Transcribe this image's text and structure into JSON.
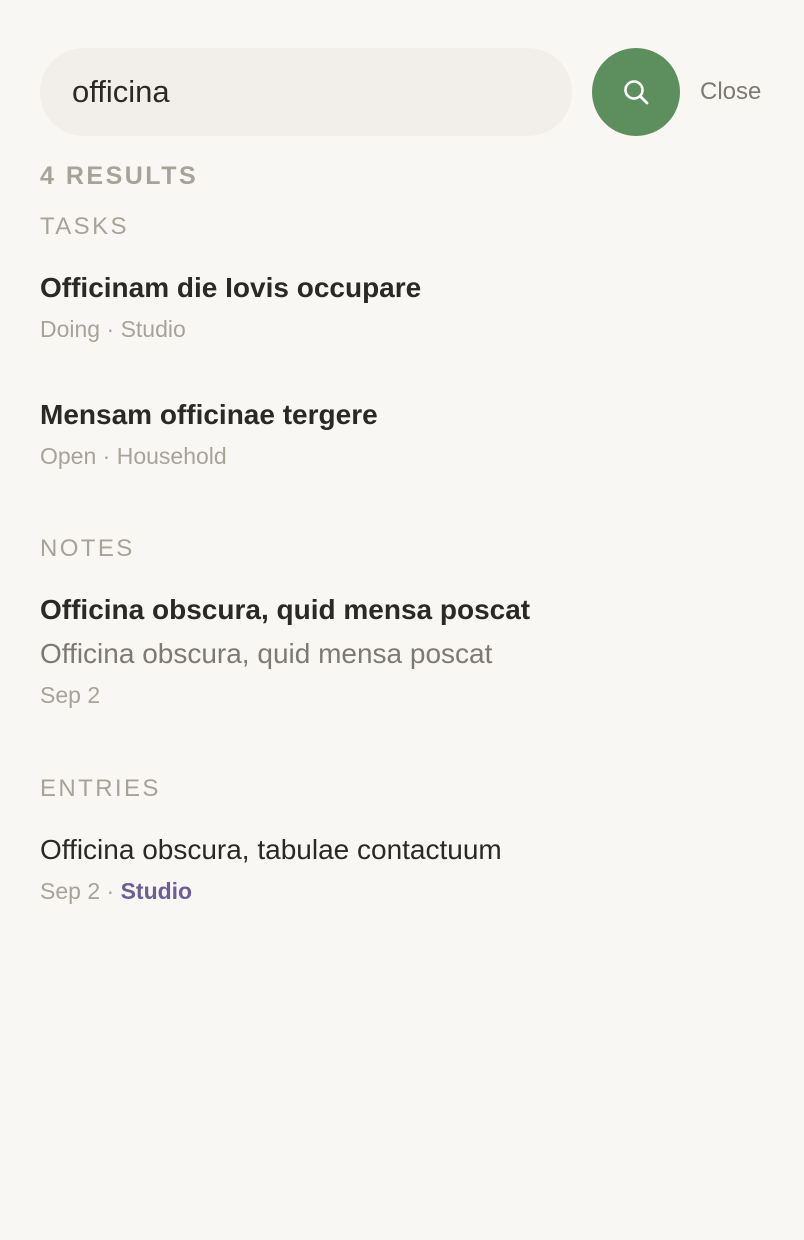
{
  "search": {
    "value": "officina",
    "button_icon": "search-icon",
    "close_label": "Close"
  },
  "results_count": "4 RESULTS",
  "colors": {
    "background": "#f9f7f3",
    "search_field": "#f2efea",
    "accent_green": "#5c8f5d",
    "muted_text": "#a8a399",
    "tag_purple": "#6c5f96"
  },
  "sections": {
    "tasks": {
      "heading": "TASKS",
      "items": [
        {
          "title": "Officinam die Iovis occupare",
          "status": "Doing",
          "separator": " · ",
          "project": "Studio"
        },
        {
          "title": "Mensam officinae tergere",
          "status": "Open",
          "separator": " · ",
          "project": "Household"
        }
      ]
    },
    "notes": {
      "heading": "NOTES",
      "items": [
        {
          "title": "Officina obscura, quid mensa poscat",
          "snippet": "Officina obscura, quid mensa poscat",
          "date": "Sep 2"
        }
      ]
    },
    "entries": {
      "heading": "ENTRIES",
      "items": [
        {
          "title": "Officina obscura, tabulae contactuum",
          "date": "Sep 2",
          "separator": " · ",
          "tag": "Studio"
        }
      ]
    }
  }
}
